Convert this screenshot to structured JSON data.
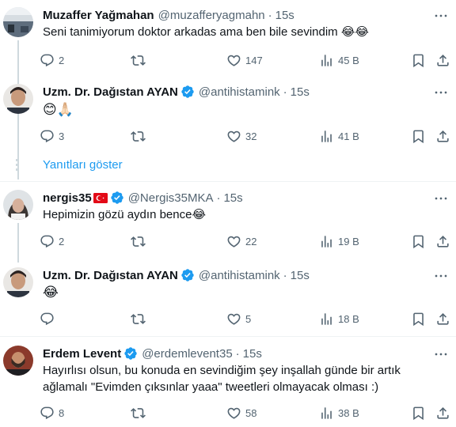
{
  "posts": [
    {
      "name": "Muzaffer Yağmahan",
      "handle": "@muzafferyagmahn",
      "separator": "·",
      "time": "15s",
      "text": "Seni tanimiyorum doktor arkadas ama ben bile sevindim 😂😂",
      "replies": "2",
      "reposts": "",
      "likes": "147",
      "views": "45 B"
    },
    {
      "name": "Uzm. Dr. Dağıstan AYAN",
      "handle": "@antihistamink",
      "separator": "·",
      "time": "15s",
      "text": "😊🙏🏻",
      "replies": "3",
      "reposts": "",
      "likes": "32",
      "views": "41 B"
    },
    {
      "name": "nergis35",
      "handle": "@Nergis35MKA",
      "separator": "·",
      "time": "15s",
      "text": "Hepimizin gözü aydın bence😂",
      "replies": "2",
      "reposts": "",
      "likes": "22",
      "views": "19 B"
    },
    {
      "name": "Uzm. Dr. Dağıstan AYAN",
      "handle": "@antihistamink",
      "separator": "·",
      "time": "15s",
      "text": "😂",
      "replies": "",
      "reposts": "",
      "likes": "5",
      "views": "18 B"
    },
    {
      "name": "Erdem Levent",
      "handle": "@erdemlevent35",
      "separator": "·",
      "time": "15s",
      "text_line1": "Hayırlısı olsun, bu konuda en sevindiğim şey inşallah günde bir artık",
      "text_line2": "ağlamalı \"Evimden çıksınlar yaaa\" tweetleri olmayacak olması :)",
      "replies": "8",
      "reposts": "",
      "likes": "58",
      "views": "38 B"
    }
  ],
  "show_replies_label": "Yanıtları göster",
  "colors": {
    "text": "#0f1419",
    "secondary": "#536471",
    "link": "#1d9bf0",
    "verified": "#1d9bf0",
    "thread_line": "#cfd9de"
  }
}
